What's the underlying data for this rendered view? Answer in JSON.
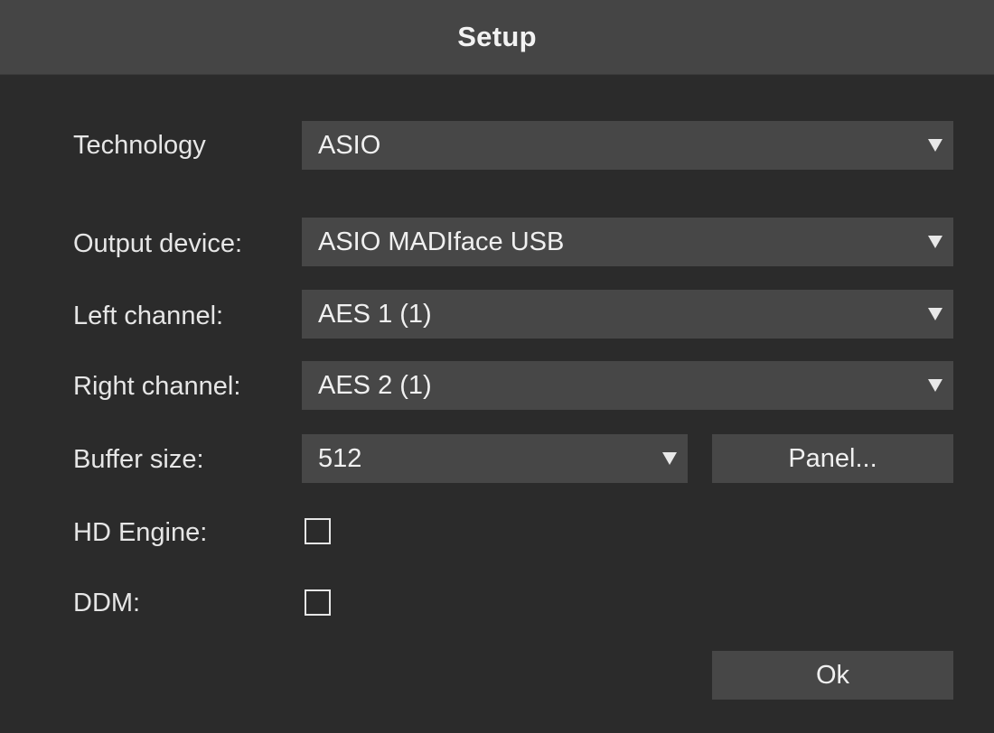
{
  "window": {
    "title": "Setup"
  },
  "form": {
    "technology": {
      "label": "Technology",
      "value": "ASIO"
    },
    "output_device": {
      "label": "Output device:",
      "value": "ASIO MADIface USB"
    },
    "left_channel": {
      "label": "Left channel:",
      "value": "AES 1 (1)"
    },
    "right_channel": {
      "label": "Right channel:",
      "value": "AES 2 (1)"
    },
    "buffer_size": {
      "label": "Buffer size:",
      "value": "512"
    },
    "panel_button": "Panel...",
    "hd_engine": {
      "label": "HD Engine:",
      "checked": false
    },
    "ddm": {
      "label": "DDM:",
      "checked": false
    },
    "ok_button": "Ok"
  },
  "icons": {
    "dropdown": "chevron-down-icon (filled triangle)",
    "checkbox": "empty-checkbox"
  },
  "colors": {
    "background": "#2b2b2b",
    "titlebar": "#454545",
    "control": "#474747",
    "text": "#e6e6e6"
  }
}
